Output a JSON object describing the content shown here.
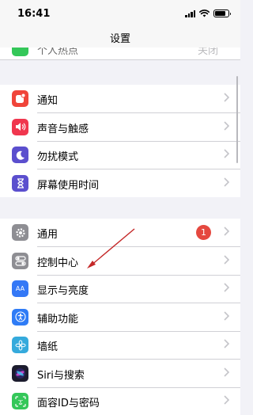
{
  "status_bar": {
    "time": "16:41",
    "battery_level": 0.8
  },
  "nav": {
    "title": "设置"
  },
  "partial_row": {
    "label": "个人热点",
    "value": "关闭"
  },
  "colors": {
    "notifications": "#f0453a",
    "sounds": "#f0364e",
    "dnd": "#5b4fce",
    "screen_time": "#5b4fce",
    "general": "#8e8e93",
    "control_center": "#8e8e93",
    "display": "#3478f6",
    "accessibility": "#2f7cf6",
    "wallpaper": "#35aadc",
    "siri": "#1c1c2e",
    "face_id": "#34c759",
    "annotation_arrow": "#c42828"
  },
  "group1": [
    {
      "label": "通知",
      "icon": "notification-icon"
    },
    {
      "label": "声音与触感",
      "icon": "speaker-icon"
    },
    {
      "label": "勿扰模式",
      "icon": "moon-icon"
    },
    {
      "label": "屏幕使用时间",
      "icon": "hourglass-icon"
    }
  ],
  "group2": [
    {
      "label": "通用",
      "icon": "gear-icon",
      "badge": "1"
    },
    {
      "label": "控制中心",
      "icon": "toggle-switches-icon"
    },
    {
      "label": "显示与亮度",
      "icon": "text-size-icon",
      "icon_text": "AA"
    },
    {
      "label": "辅助功能",
      "icon": "accessibility-icon"
    },
    {
      "label": "墙纸",
      "icon": "flower-icon"
    },
    {
      "label": "Siri与搜索",
      "icon": "siri-icon"
    },
    {
      "label": "面容ID与密码",
      "icon": "face-id-icon"
    }
  ]
}
